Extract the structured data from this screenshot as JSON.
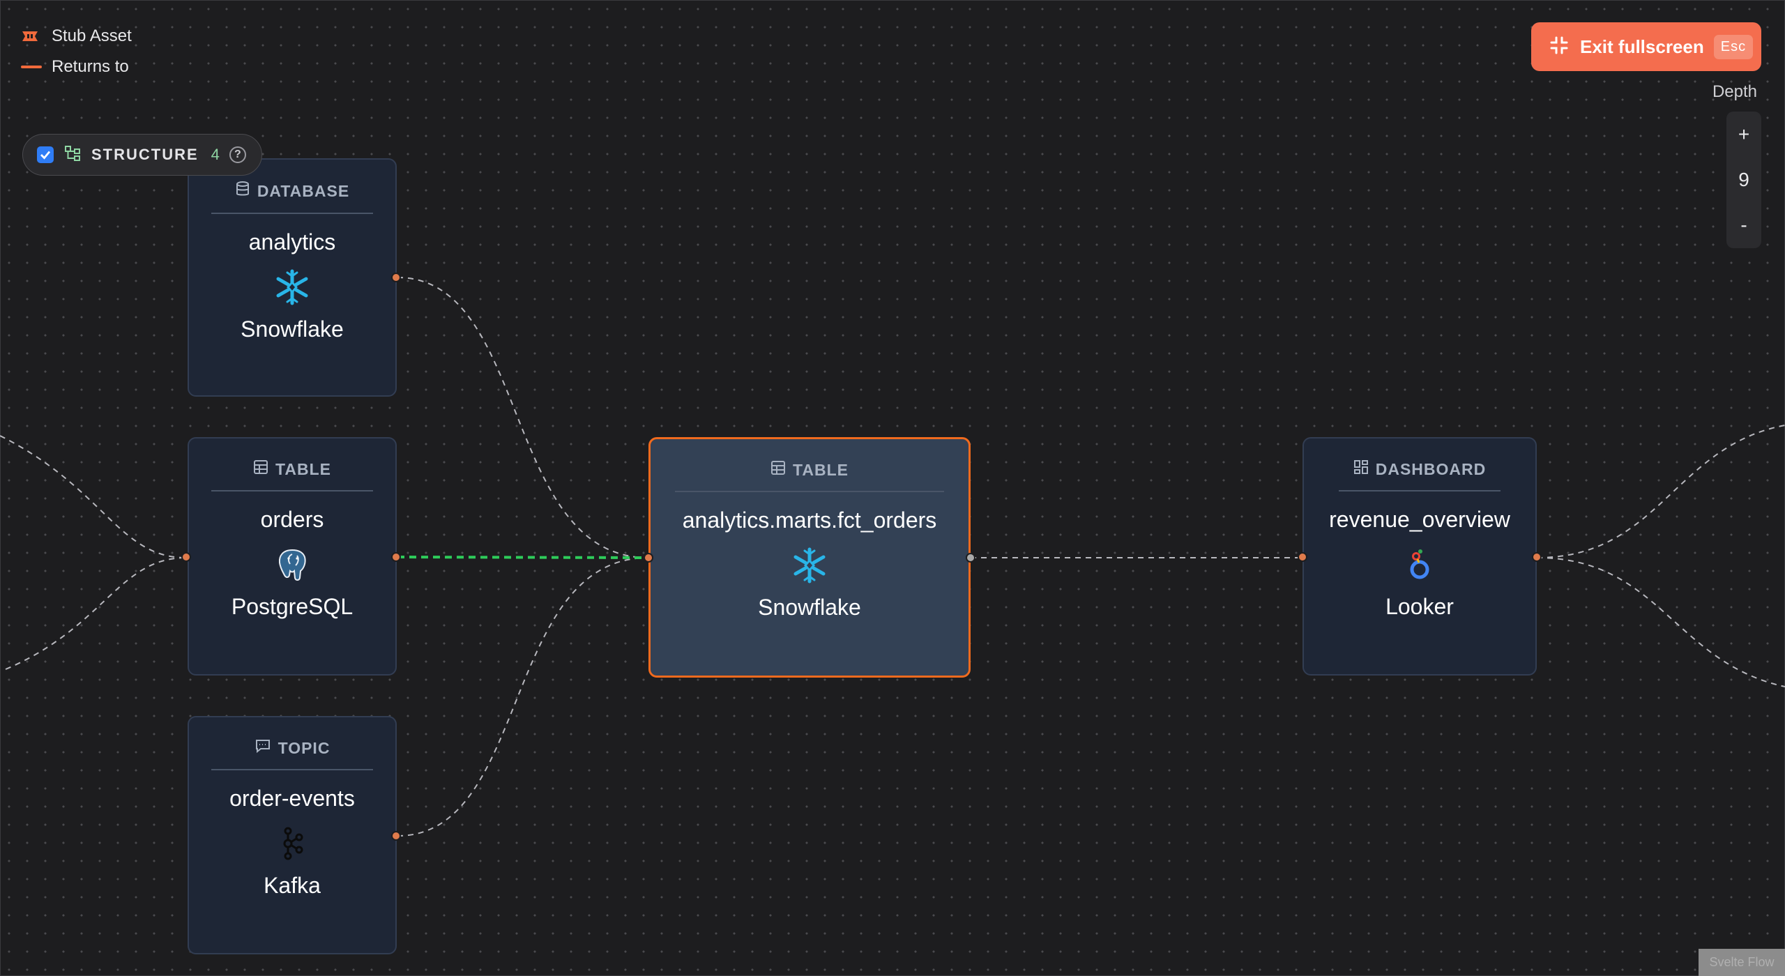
{
  "legend": {
    "stub_asset": "Stub Asset",
    "returns_to": "Returns to"
  },
  "structure": {
    "label": "STRUCTURE",
    "count": "4",
    "help": "?",
    "checked": true
  },
  "toolbar": {
    "exit_label": "Exit fullscreen",
    "exit_shortcut": "Esc"
  },
  "depth": {
    "label": "Depth",
    "plus": "+",
    "value": "9",
    "minus": "-"
  },
  "nodes": [
    {
      "type": "DATABASE",
      "name": "analytics",
      "platform": "Snowflake",
      "icon": "database-icon",
      "logo": "snowflake-logo"
    },
    {
      "type": "TABLE",
      "name": "orders",
      "platform": "PostgreSQL",
      "icon": "table-icon",
      "logo": "postgresql-logo"
    },
    {
      "type": "TOPIC",
      "name": "order-events",
      "platform": "Kafka",
      "icon": "topic-icon",
      "logo": "kafka-logo"
    },
    {
      "type": "TABLE",
      "name": "analytics.marts.fct_orders",
      "platform": "Snowflake",
      "icon": "table-icon",
      "logo": "snowflake-logo",
      "selected": true
    },
    {
      "type": "DASHBOARD",
      "name": "revenue_overview",
      "platform": "Looker",
      "icon": "dashboard-icon",
      "logo": "looker-logo"
    }
  ],
  "watermark": "Svelte Flow",
  "colors": {
    "accent": "#f46d4e",
    "selected_border": "#f06a1e",
    "highlight_edge": "#2ecc5a",
    "node_bg": "#1e2636"
  }
}
